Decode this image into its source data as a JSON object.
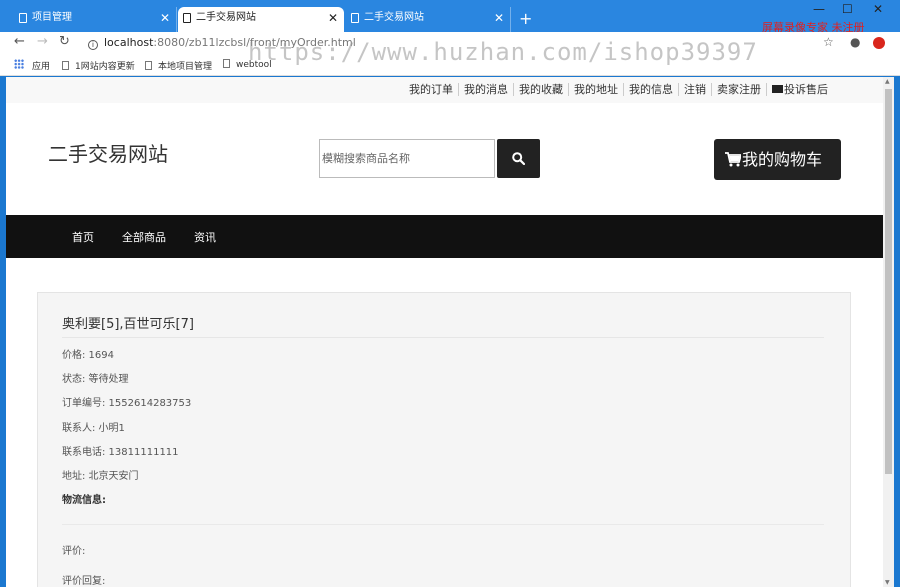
{
  "browser": {
    "tabs": [
      {
        "title": "项目管理",
        "active": false
      },
      {
        "title": "二手交易网站",
        "active": true
      },
      {
        "title": "二手交易网站",
        "active": false
      }
    ],
    "new_tab": "+",
    "url_host": "localhost",
    "url_path": ":8080/zb11lzcbsl/front/myOrder.html",
    "watermark_url": "https://www.huzhan.com/ishop39397",
    "watermark_top": "屏幕录像专家 未注册",
    "bookmarks": [
      "应用",
      "1网站内容更新",
      "本地项目管理",
      "webtool"
    ],
    "window_controls": {
      "minimize": "—",
      "maximize": "☐",
      "close": "✕"
    }
  },
  "site": {
    "toplinks": [
      "我的订单",
      "我的消息",
      "我的收藏",
      "我的地址",
      "我的信息",
      "注销",
      "卖家注册",
      "投诉售后"
    ],
    "title": "二手交易网站",
    "search_placeholder": "模糊搜索商品名称",
    "cart_label": "我的购物车",
    "nav": [
      "首页",
      "全部商品",
      "资讯"
    ]
  },
  "order": {
    "title": "奥利要[5],百世可乐[7]",
    "price": "价格: 1694",
    "status": "状态: 等待处理",
    "order_no": "订单编号: 1552614283753",
    "contact": "联系人: 小明1",
    "phone": "联系电话: 13811111111",
    "address": "地址: 北京天安门",
    "logistics": "物流信息:",
    "review": "评价:",
    "review_reply": "评价回复:"
  },
  "icons": {
    "search": "search-icon",
    "cart": "cart-icon",
    "mail": "mail-icon"
  },
  "colors": {
    "chrome_blue": "#2a86e0",
    "nav_black": "#111111",
    "watermark_red": "#e02020"
  }
}
